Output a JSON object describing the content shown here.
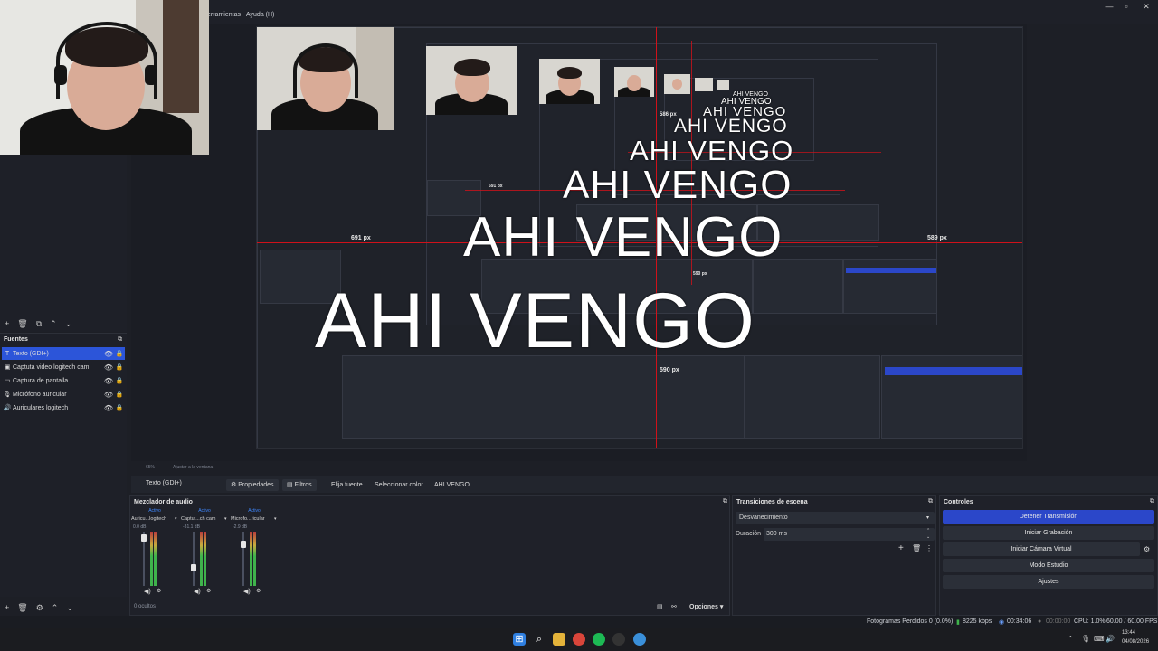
{
  "menu": {
    "tools_label": "erramientas",
    "help_label": "Ayuda (H)"
  },
  "window_controls": {
    "minimize": "—",
    "maximize": "▫",
    "close": "✕"
  },
  "icons": {
    "eye": "👁",
    "lock": "🔒",
    "gear": "⚙",
    "plus": "+",
    "trash": "🗑",
    "up": "⌃",
    "down": "⌄",
    "menu": "⋮"
  },
  "preview": {
    "overlay_text": "AHI VENGO",
    "measure_left": "691 px",
    "measure_right": "589 px",
    "measure_bottom": "590 px",
    "measure_top": "586 px",
    "nested_left": "691 px",
    "nested_bottom": "590 px",
    "zoom_label": "65%",
    "zoom_hint": "Ajustar a la ventana"
  },
  "scenes_dock": {
    "toolbar": [
      "+",
      "🗑",
      "⧉",
      "⌃",
      "⌄"
    ]
  },
  "sources_dock": {
    "title": "Fuentes",
    "items": [
      {
        "icon": "T",
        "label": "Texto (GDI+)",
        "selected": true
      },
      {
        "icon": "▣",
        "label": "Captuta video logitech cam",
        "selected": false
      },
      {
        "icon": "▭",
        "label": "Captura de pantalla",
        "selected": false
      },
      {
        "icon": "🎙",
        "label": "Micrófono auricular",
        "selected": false
      },
      {
        "icon": "🔊",
        "label": "Auriculares logitech",
        "selected": false
      }
    ],
    "toolbar": [
      "+",
      "🗑",
      "⚙",
      "⌃",
      "⌄"
    ]
  },
  "source_toolbar": {
    "source_name": "Texto (GDI+)",
    "properties": "Propiedades",
    "filters": "Filtros",
    "choose_font": "Elija fuente",
    "choose_color": "Seleccionar color",
    "text_value": "AHI VENGO"
  },
  "mixer": {
    "title": "Mezclador de audio",
    "channels": [
      {
        "active": "Activo",
        "name": "Auricu...logitech",
        "db": "0.0 dB"
      },
      {
        "active": "Activo",
        "name": "Captut...ch cam",
        "db": "-31.1 dB"
      },
      {
        "active": "Activo",
        "name": "Microfo...ricular",
        "db": "-2.9 dB"
      }
    ],
    "hidden_count": "0 ocultos",
    "options": "Opciones"
  },
  "transitions": {
    "title": "Transiciones de escena",
    "selected": "Desvanecimiento",
    "duration_label": "Duración",
    "duration_value": "300 ms"
  },
  "controls": {
    "title": "Controles",
    "buttons": [
      "Detener Transmisión",
      "Iniciar Grabación",
      "Iniciar Cámara Virtual",
      "Modo Estudio",
      "Ajustes"
    ]
  },
  "status": {
    "dropped": "Fotogramas Perdidos 0 (0.0%)",
    "bitrate": "8225 kbps",
    "stream_time": "00:34:06",
    "rec_time": "00:00:00",
    "cpu": "CPU: 1.0%",
    "fps": "60.00 / 60.00 FPS"
  },
  "taskbar": {
    "time": "13:44",
    "date": "04/08/2026"
  },
  "colors": {
    "accent": "#2b47c9",
    "selection": "#2c55d9",
    "guide_red": "#d0111a",
    "active_text": "#3f88ff"
  }
}
